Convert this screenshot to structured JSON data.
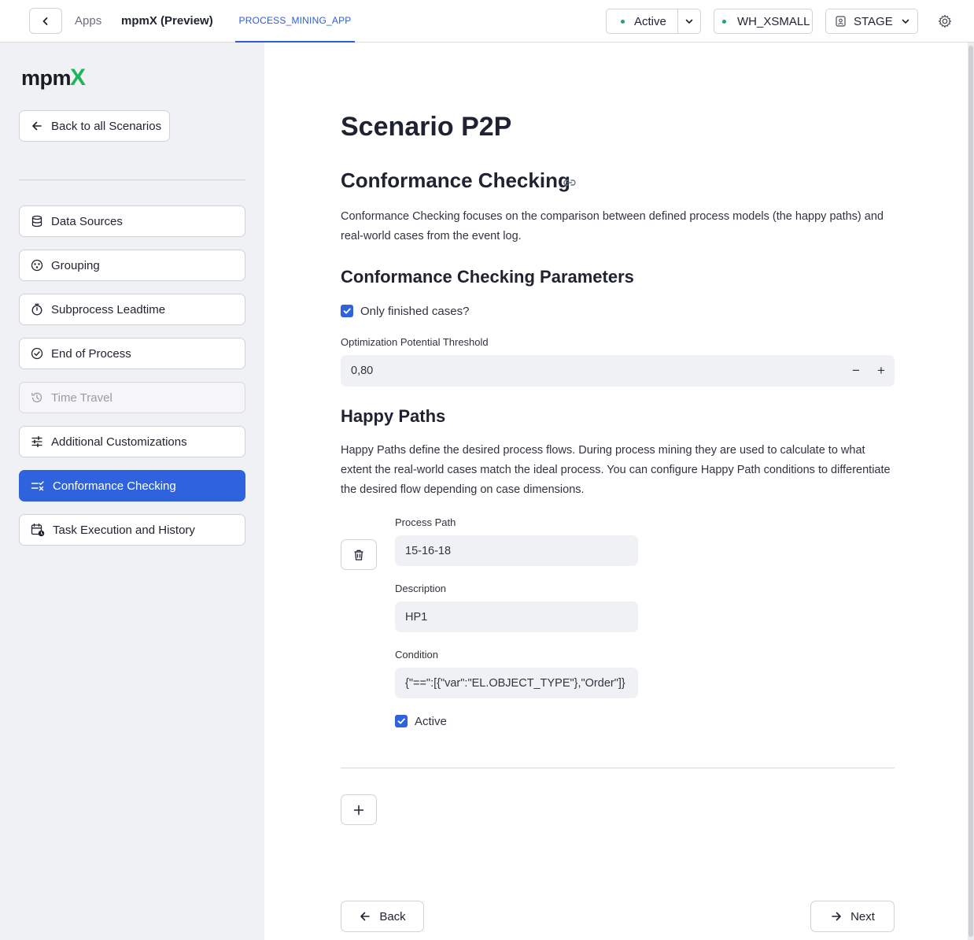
{
  "topbar": {
    "apps_label": "Apps",
    "app_name": "mpmX (Preview)",
    "tab_label": "PROCESS_MINING_APP",
    "status_label": "Active",
    "warehouse_label": "WH_XSMALL",
    "role_label": "STAGE"
  },
  "sidebar": {
    "logo_text": "mpm",
    "logo_accent": "X",
    "back_label": "Back to all Scenarios",
    "items": [
      {
        "label": "Data Sources",
        "icon": "database-icon",
        "state": "normal"
      },
      {
        "label": "Grouping",
        "icon": "grouping-icon",
        "state": "normal"
      },
      {
        "label": "Subprocess Leadtime",
        "icon": "timer-icon",
        "state": "normal"
      },
      {
        "label": "End of Process",
        "icon": "check-circle-icon",
        "state": "normal"
      },
      {
        "label": "Time Travel",
        "icon": "history-icon",
        "state": "disabled"
      },
      {
        "label": "Additional Customizations",
        "icon": "sliders-icon",
        "state": "normal"
      },
      {
        "label": "Conformance Checking",
        "icon": "checklist-icon",
        "state": "selected"
      },
      {
        "label": "Task Execution and History",
        "icon": "calendar-clock-icon",
        "state": "normal"
      }
    ]
  },
  "main": {
    "title": "Scenario P2P",
    "section_title": "Conformance Checking",
    "section_desc": "Conformance Checking focuses on the comparison between defined process models (the happy paths) and real-world cases from the event log.",
    "params_title": "Conformance Checking Parameters",
    "only_finished_label": "Only finished cases?",
    "only_finished_checked": true,
    "threshold_label": "Optimization Potential Threshold",
    "threshold_value": "0,80",
    "happy_title": "Happy Paths",
    "happy_desc": "Happy Paths define the desired process flows. During process mining they are used to calculate to what extent the real-world cases match the ideal process. You can configure Happy Path conditions to differentiate the desired flow depending on case dimensions.",
    "happy_path": {
      "process_path_label": "Process Path",
      "process_path_value": "15-16-18",
      "description_label": "Description",
      "description_value": "HP1",
      "condition_label": "Condition",
      "condition_value": "{\"==\":[{\"var\":\"EL.OBJECT_TYPE\"},\"Order\"]}",
      "active_label": "Active",
      "active_checked": true
    },
    "back_label": "Back",
    "next_label": "Next"
  },
  "colors": {
    "accent": "#2f63dd",
    "status_dot": "#21a36a",
    "logo_accent": "#1fb45a",
    "sidebar_bg": "#f0f1f4"
  }
}
